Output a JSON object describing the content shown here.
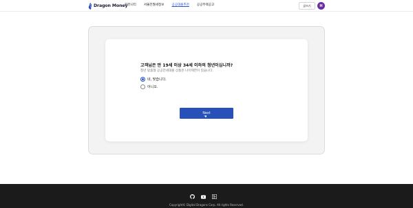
{
  "brand": {
    "name": "Dragon Money"
  },
  "nav": {
    "items": [
      {
        "label": "커뮤니티"
      },
      {
        "label": "서울전월세정보"
      },
      {
        "label": "공공대출추천"
      },
      {
        "label": "공공주택공고"
      }
    ],
    "active_index": 2
  },
  "header": {
    "write_label": "글쓰기",
    "avatar_initial": "H"
  },
  "quiz": {
    "question": "고객님은 만 19세 이상 34세 이하의 청년이십니까?",
    "description": "청년 맞춤형 공공전세대출 상품은 나이제한이 있습니다.",
    "options": [
      {
        "label": "네, 맞습니다.",
        "selected": true
      },
      {
        "label": "아니오.",
        "selected": false
      }
    ],
    "next_label": "Next"
  },
  "footer": {
    "social_icons": [
      "github-icon",
      "youtube-icon",
      "blog-icon"
    ],
    "copyright": "Copyright© Digital Dragons Corp. All rights Reserved."
  },
  "colors": {
    "accent": "#2750b8",
    "avatar": "#6b2fa3",
    "footer_bg": "#1b1b1b"
  }
}
